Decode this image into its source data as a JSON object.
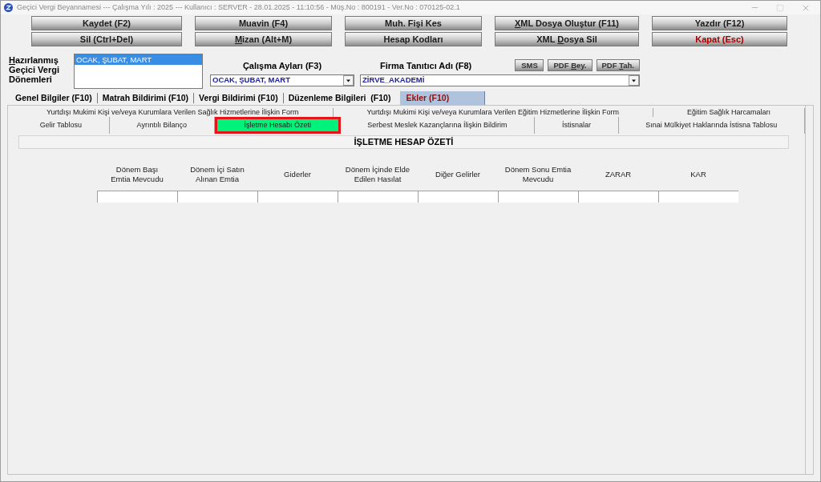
{
  "window": {
    "title": "Geçici Vergi Beyannamesi --- Çalışma Yılı : 2025 --- Kullanıcı : SERVER - 28.01.2025 - 11:10:56 - Müş.No : 800191 - Ver.No : 070125-02.1"
  },
  "toolbar": {
    "upper": [
      {
        "label": "Kaydet (F2)",
        "kind": "action"
      },
      {
        "label": "Muavin (F4)",
        "kind": "action"
      },
      {
        "label": "Muh. Fişi Kes",
        "kind": "action"
      },
      {
        "label": [
          {
            "text": "X",
            "underline": true
          },
          {
            "text": "ML Dosya Oluştur (F11)",
            "underline": false
          }
        ],
        "kind": "action"
      },
      {
        "label": "Yazdır (F12)",
        "kind": "action"
      }
    ],
    "lower": [
      {
        "label": "Sil (Ctrl+Del)",
        "kind": "action"
      },
      {
        "label": [
          {
            "text": "M",
            "underline": true
          },
          {
            "text": "izan (Alt+M)",
            "underline": false
          }
        ],
        "kind": "action"
      },
      {
        "label": "Hesap Kodları",
        "kind": "action"
      },
      {
        "label": [
          {
            "text": "XML ",
            "underline": false
          },
          {
            "text": "D",
            "underline": true
          },
          {
            "text": "osya Sil",
            "underline": false
          }
        ],
        "kind": "action"
      },
      {
        "label": "Kapat (Esc)",
        "kind": "exit"
      }
    ]
  },
  "periods": {
    "label": [
      {
        "text": "H",
        "underline": true
      },
      {
        "text": "azırlanmış Geçici Vergi Dönemleri",
        "underline": false
      }
    ],
    "items": [
      {
        "label": "OCAK, ŞUBAT, MART",
        "selected": true
      }
    ]
  },
  "work_months": {
    "label": "Çalışma Ayları (F3)",
    "value": "OCAK, ŞUBAT, MART"
  },
  "company": {
    "label": "Firma Tanıtıcı Adı (F8)",
    "value": "ZİRVE_AKADEMİ"
  },
  "report_buttons": [
    {
      "label": "SMS"
    },
    {
      "label": [
        {
          "text": "PDF ",
          "underline": false
        },
        {
          "text": "B",
          "underline": true
        },
        {
          "text": "ey.",
          "underline": false
        }
      ]
    },
    {
      "label": [
        {
          "text": "PDF ",
          "underline": false
        },
        {
          "text": "T",
          "underline": true
        },
        {
          "text": "ah.",
          "underline": false
        }
      ]
    }
  ],
  "tabs": [
    {
      "label": "Genel Bilgiler (F10)",
      "selected": false
    },
    {
      "label": "Matrah Bildirimi (F10)",
      "selected": false
    },
    {
      "label": "Vergi Bildirimi (F10)",
      "selected": false
    },
    {
      "label": "Düzenleme Bilgileri  (F10)",
      "selected": false
    },
    {
      "label": "Ekler (F10)",
      "selected": true
    }
  ],
  "sub_tabs": {
    "upper": [
      {
        "label": "Yurtdışı Mukimi Kişi ve/veya Kurumlara Verilen Sağlık Hizmetlerine İlişkin Form",
        "selected": false
      },
      {
        "label": "Yurtdışı Mukimi Kişi ve/veya Kurumlara Verilen Eğitim Hizmetlerine İlişkin Form",
        "selected": false
      },
      {
        "label": "Eğitim Sağlık Harcamaları",
        "selected": false
      }
    ],
    "lower": [
      {
        "label": "Gelir Tablosu",
        "selected": false
      },
      {
        "label": "Ayrıntılı Bilanço",
        "selected": false
      },
      {
        "label": "İşletme Hesabı Özeti",
        "selected": true
      },
      {
        "label": "Serbest Meslek Kazançlarına İlişkin Bildirim",
        "selected": false
      },
      {
        "label": "İstisnalar",
        "selected": false
      },
      {
        "label": "Sınai Mülkiyet Haklarında İstisna Tablosu",
        "selected": false
      }
    ]
  },
  "summary": {
    "title": "İŞLETME HESAP ÖZETİ",
    "columns": [
      "Dönem Başı\nEmtia Mevcudu",
      "Dönem İçi Satın\nAlınan Emtia",
      "Giderler",
      "Dönem İçinde Elde\nEdilen Hasılat",
      "Diğer Gelirler",
      "Dönem Sonu Emtia\nMevcudu",
      "ZARAR",
      "KAR"
    ]
  }
}
